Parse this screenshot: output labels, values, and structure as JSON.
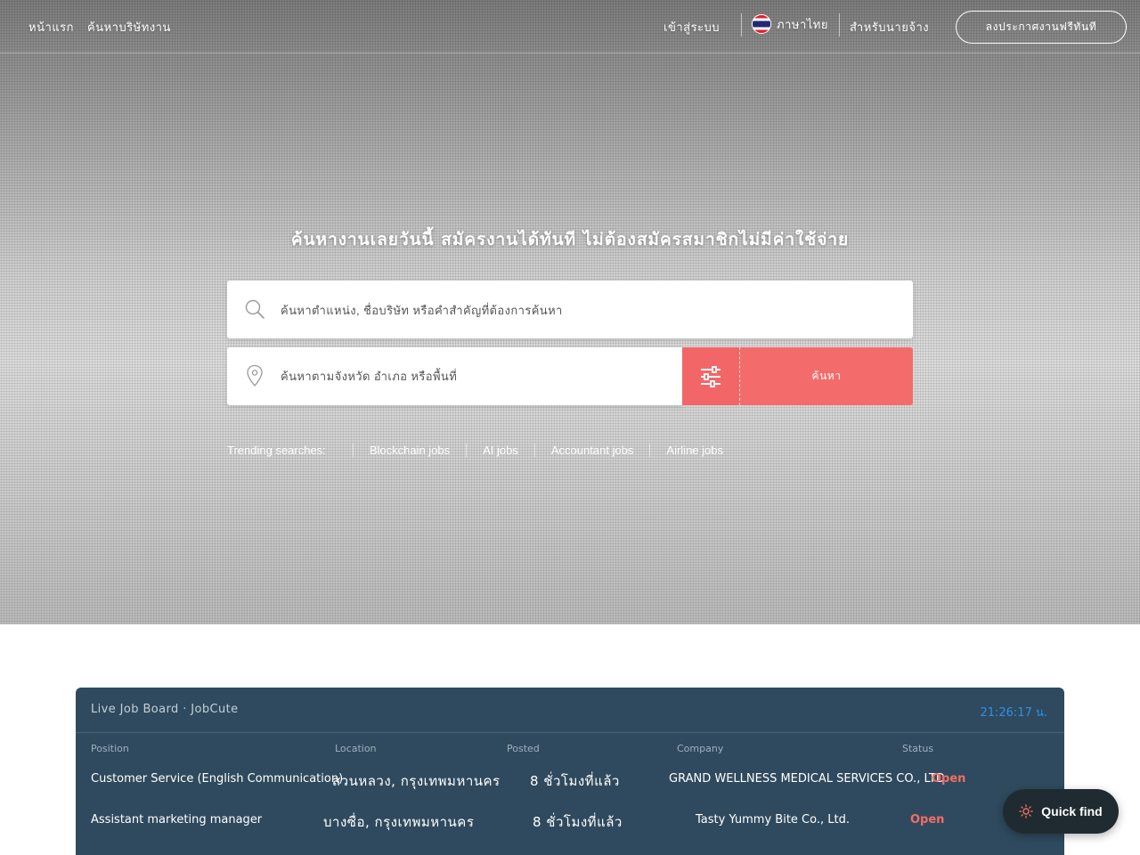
{
  "nav": {
    "home_label": "หน้าแรก",
    "company_label": "ค้นหาบริษัทงาน",
    "login_label": "เข้าสู่ระบบ",
    "language_label": "ภาษาไทย",
    "employer_label": "สำหรับนายจ้าง",
    "post_job_label": "ลงประกาศงานฟรีทันที",
    "flag_icon": "thailand-flag-icon"
  },
  "hero": {
    "headline": "ค้นหางานเลยวันนี้ สมัครงานได้ทันที ไม่ต้องสมัครสมาชิกไม่มีค่าใช้จ่าย"
  },
  "search": {
    "keyword_placeholder": "ค้นหาตำแหน่ง, ชื่อบริษัท หรือคำสำคัญที่ต้องการค้นหา",
    "location_placeholder": "ค้นหาตามจังหวัด อำเภอ หรือพื้นที่",
    "submit_label": "ค้นหา",
    "search_icon": "search-icon",
    "location_icon": "map-pin-icon",
    "filter_icon": "sliders-icon"
  },
  "trending": {
    "label": "Trending searches:",
    "items": [
      "Blockchain jobs",
      "AI jobs",
      "Accountant jobs",
      "Airline jobs"
    ]
  },
  "board": {
    "title": "Live Job Board · JobCute",
    "clock": "21:26:17 น.",
    "columns": [
      "Position",
      "Location",
      "Posted",
      "Company",
      "Status"
    ],
    "rows": [
      {
        "position": "Customer Service (English Communication)",
        "location": "สวนหลวง, กรุงเทพมหานคร",
        "posted": "8 ชั่วโมงที่แล้ว",
        "company": "GRAND WELLNESS MEDICAL SERVICES CO., LTD.",
        "status": "Open"
      },
      {
        "position": "Assistant marketing manager",
        "location": "บางซื่อ, กรุงเทพมหานคร",
        "posted": "8 ชั่วโมงที่แล้ว",
        "company": "Tasty Yummy Bite Co., Ltd.",
        "status": "Open"
      }
    ]
  },
  "quick_find": {
    "label": "Quick find",
    "icon": "sun-icon"
  },
  "colors": {
    "accent": "#f46b6b",
    "board_bg": "#2f4a5e",
    "clock": "#2f8fe6",
    "status_open": "#f26e64",
    "quick_find_bg": "#1f2b30"
  }
}
